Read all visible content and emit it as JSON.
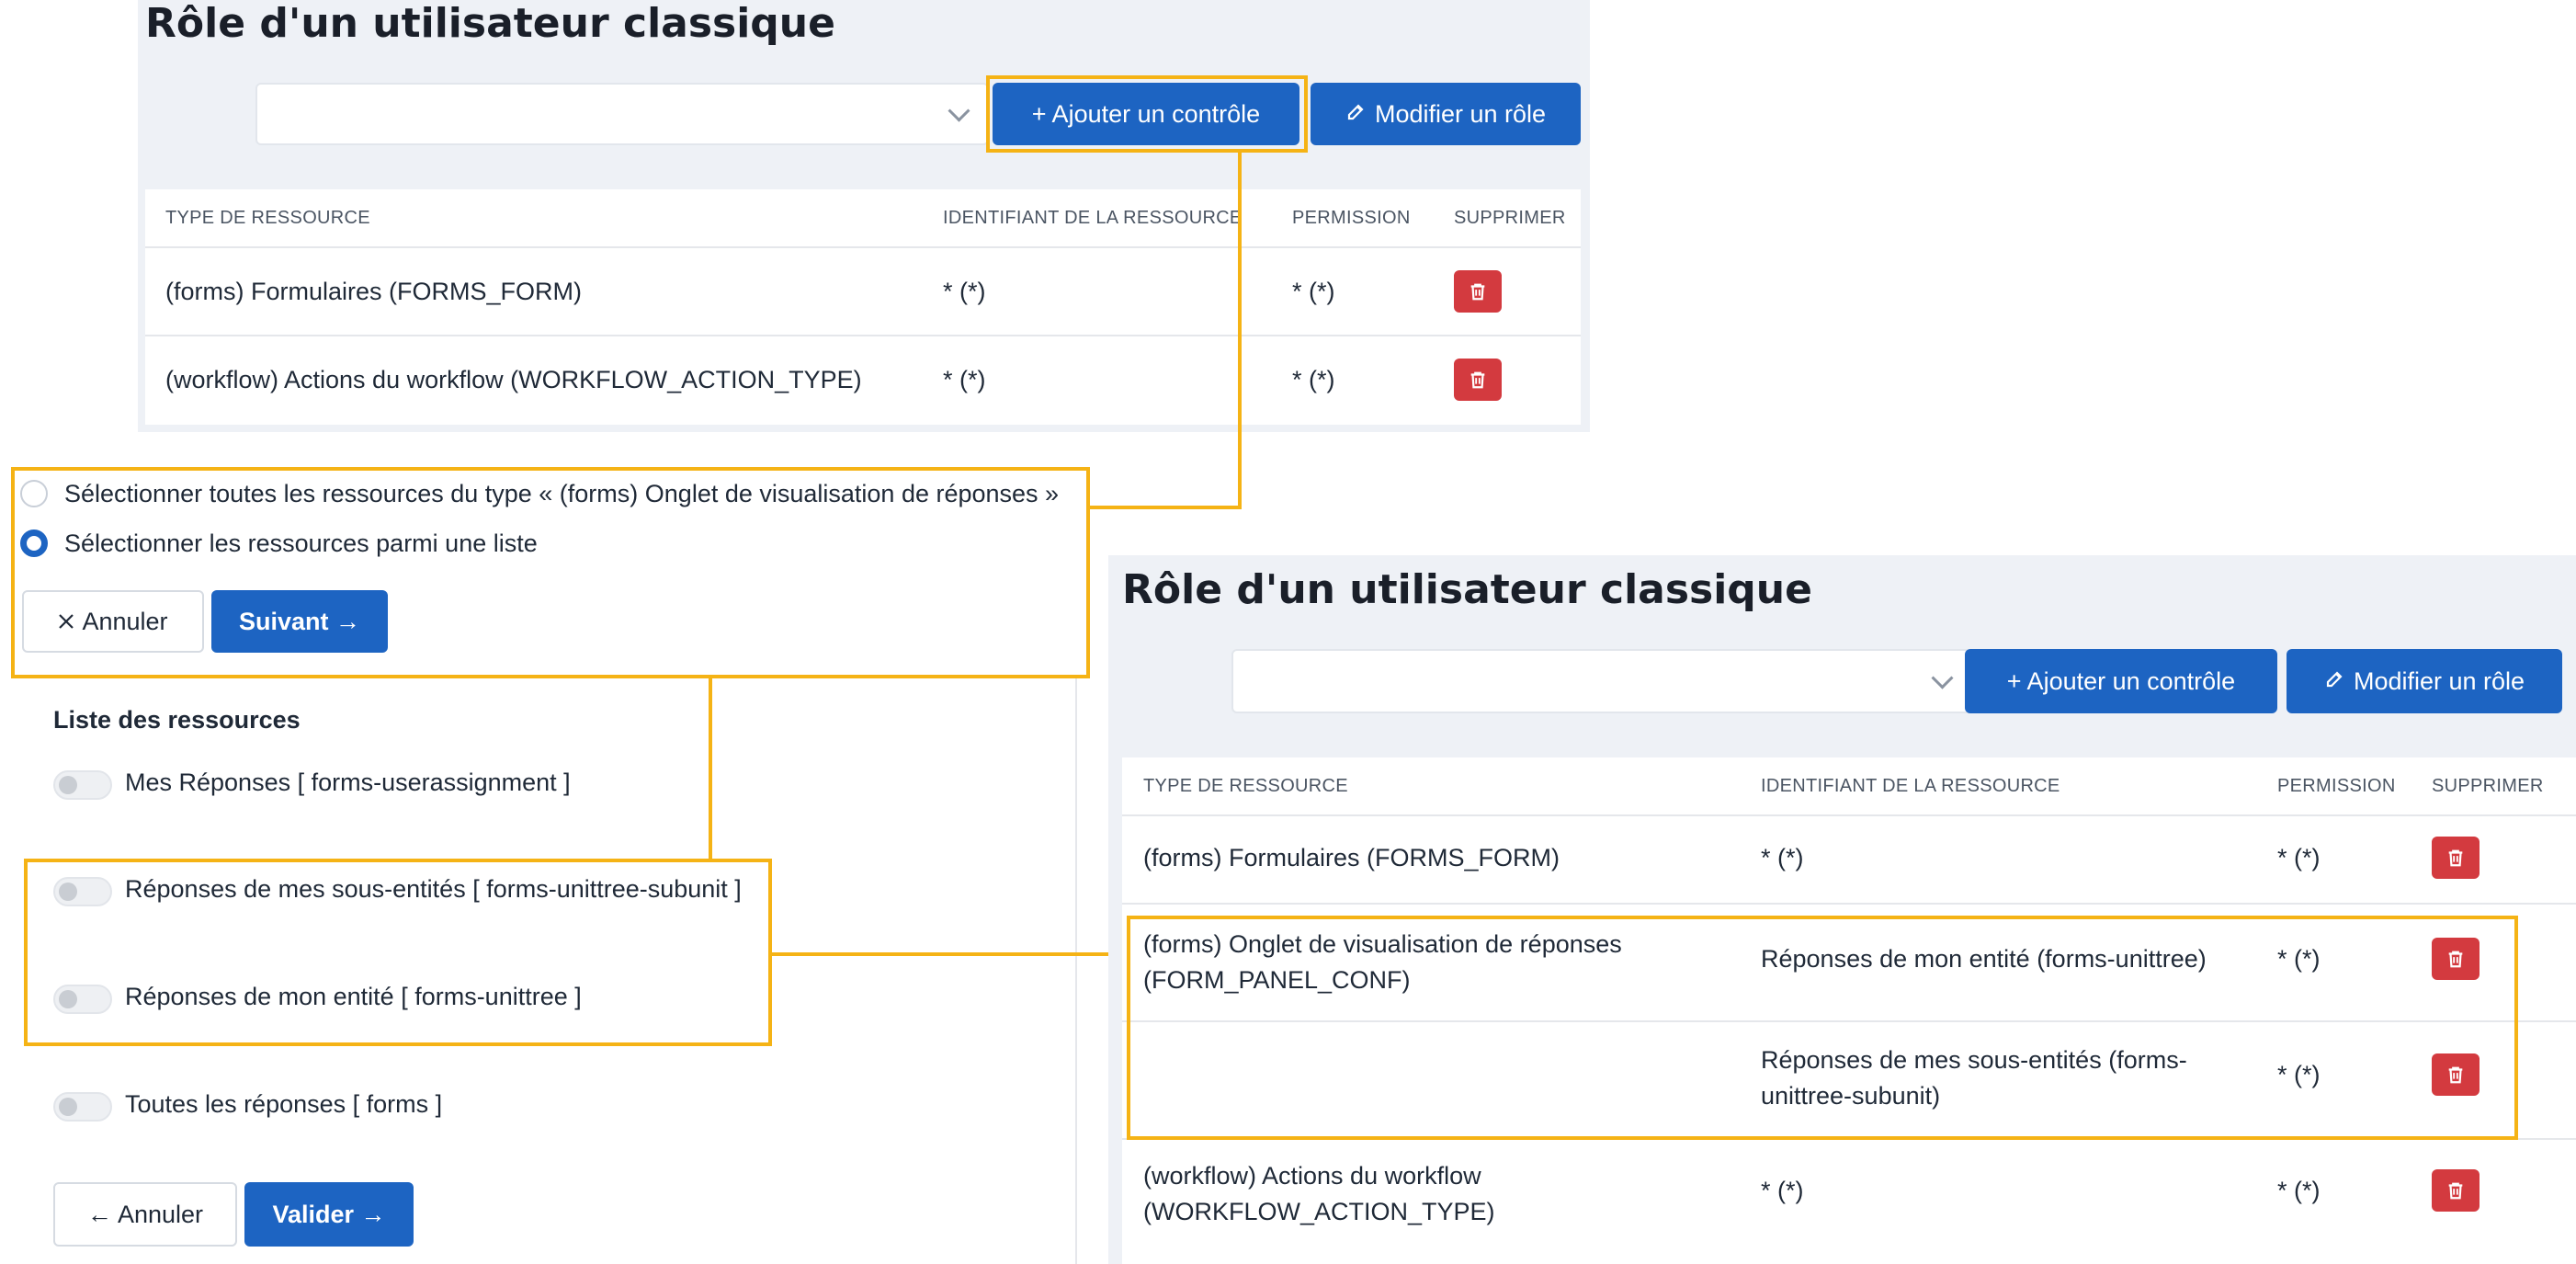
{
  "colors": {
    "primary": "#1d64c2",
    "danger": "#d33a3f",
    "highlight": "#f5b315",
    "panel_bg": "#eef1f6"
  },
  "top": {
    "title": "Rôle d'un utilisateur classique",
    "add_control": {
      "icon": "plus-icon",
      "label": "+ Ajouter un contrôle"
    },
    "edit_role": {
      "icon": "edit-icon",
      "label": "Modifier un rôle"
    },
    "table": {
      "headers": [
        "TYPE DE RESSOURCE",
        "IDENTIFIANT DE LA RESSOURCE",
        "PERMISSION",
        "SUPPRIMER"
      ],
      "rows": [
        {
          "type": "(forms) Formulaires (FORMS_FORM)",
          "id": "* (*)",
          "permission": "* (*)"
        },
        {
          "type": "(workflow) Actions du workflow (WORKFLOW_ACTION_TYPE)",
          "id": "* (*)",
          "permission": "* (*)"
        }
      ]
    }
  },
  "selection": {
    "option_all": "Sélectionner toutes les ressources du type « (forms) Onglet de visualisation de réponses »",
    "option_list": "Sélectionner les ressources parmi une liste",
    "selected": "list",
    "cancel": {
      "icon": "close-icon",
      "label": "Annuler"
    },
    "next": {
      "icon": "arrow-right-icon",
      "label": "Suivant →"
    }
  },
  "resources": {
    "heading": "Liste des ressources",
    "items": [
      "Mes Réponses [ forms-userassignment ]",
      "Réponses de mes sous-entités [ forms-unittree-subunit ]",
      "Réponses de mon entité [ forms-unittree ]",
      "Toutes les réponses [ forms ]"
    ],
    "cancel": {
      "icon": "arrow-left-icon",
      "label": "← Annuler"
    },
    "validate": {
      "icon": "arrow-right-icon",
      "label": "Valider →"
    }
  },
  "bottom": {
    "title": "Rôle d'un utilisateur classique",
    "add_control": {
      "icon": "plus-icon",
      "label": "+ Ajouter un contrôle"
    },
    "edit_role": {
      "icon": "edit-icon",
      "label": "Modifier un rôle"
    },
    "table": {
      "headers": [
        "TYPE DE RESSOURCE",
        "IDENTIFIANT DE LA RESSOURCE",
        "PERMISSION",
        "SUPPRIMER"
      ],
      "rows": [
        {
          "type": "(forms) Formulaires (FORMS_FORM)",
          "id": "* (*)",
          "permission": "* (*)"
        },
        {
          "type": "(forms) Onglet de visualisation de réponses (FORM_PANEL_CONF)",
          "id": "Réponses de mon entité (forms-unittree)",
          "permission": "* (*)"
        },
        {
          "type": "",
          "id": "Réponses de mes sous-entités (forms-unittree-subunit)",
          "permission": "* (*)"
        },
        {
          "type": "(workflow) Actions du workflow (WORKFLOW_ACTION_TYPE)",
          "id": "* (*)",
          "permission": "* (*)"
        }
      ]
    }
  }
}
